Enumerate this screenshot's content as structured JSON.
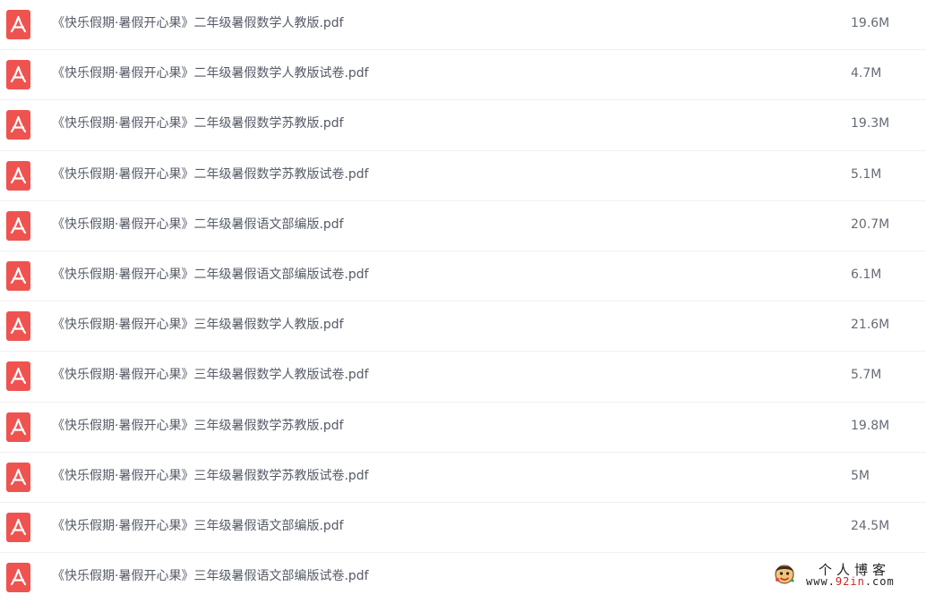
{
  "colors": {
    "pdf_icon_bg": "#ef5350",
    "name_text": "#555b66",
    "size_text": "#666c75",
    "row_divider": "#eef0f3",
    "watermark_accent": "#d22222"
  },
  "files": [
    {
      "icon": "pdf-icon",
      "name": "《快乐假期·暑假开心果》二年级暑假数学人教版.pdf",
      "size": "19.6M"
    },
    {
      "icon": "pdf-icon",
      "name": "《快乐假期·暑假开心果》二年级暑假数学人教版试卷.pdf",
      "size": "4.7M"
    },
    {
      "icon": "pdf-icon",
      "name": "《快乐假期·暑假开心果》二年级暑假数学苏教版.pdf",
      "size": "19.3M"
    },
    {
      "icon": "pdf-icon",
      "name": "《快乐假期·暑假开心果》二年级暑假数学苏教版试卷.pdf",
      "size": "5.1M"
    },
    {
      "icon": "pdf-icon",
      "name": "《快乐假期·暑假开心果》二年级暑假语文部编版.pdf",
      "size": "20.7M"
    },
    {
      "icon": "pdf-icon",
      "name": "《快乐假期·暑假开心果》二年级暑假语文部编版试卷.pdf",
      "size": "6.1M"
    },
    {
      "icon": "pdf-icon",
      "name": "《快乐假期·暑假开心果》三年级暑假数学人教版.pdf",
      "size": "21.6M"
    },
    {
      "icon": "pdf-icon",
      "name": "《快乐假期·暑假开心果》三年级暑假数学人教版试卷.pdf",
      "size": "5.7M"
    },
    {
      "icon": "pdf-icon",
      "name": "《快乐假期·暑假开心果》三年级暑假数学苏教版.pdf",
      "size": "19.8M"
    },
    {
      "icon": "pdf-icon",
      "name": "《快乐假期·暑假开心果》三年级暑假数学苏教版试卷.pdf",
      "size": "5M"
    },
    {
      "icon": "pdf-icon",
      "name": "《快乐假期·暑假开心果》三年级暑假语文部编版.pdf",
      "size": "24.5M"
    },
    {
      "icon": "pdf-icon",
      "name": "《快乐假期·暑假开心果》三年级暑假语文部编版试卷.pdf",
      "size": ""
    }
  ],
  "watermark": {
    "title": "个人博客",
    "url_prefix": "www.",
    "url_accent": "92in",
    "url_suffix": ".com",
    "logo_icon": "cartoon-face-logo-icon"
  }
}
